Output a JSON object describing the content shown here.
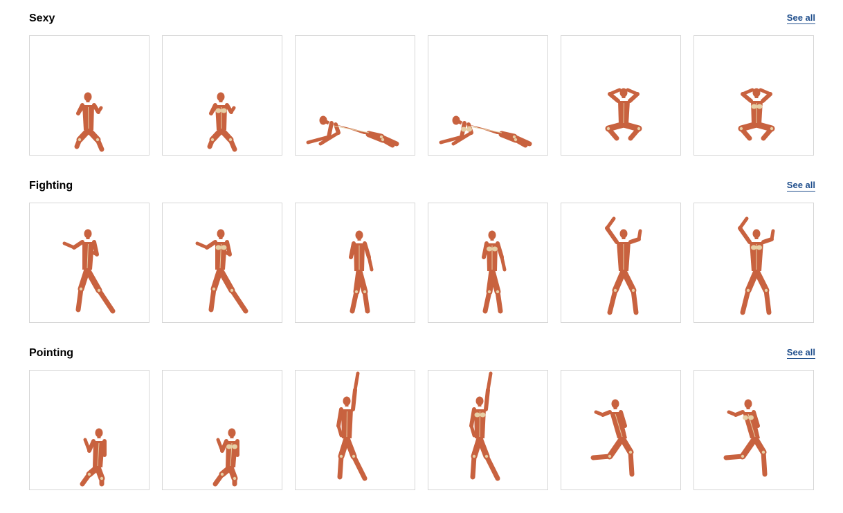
{
  "sections": [
    {
      "title": "Sexy",
      "see_all": "See all",
      "items": [
        {
          "pose": "kneeling-hands-raised",
          "figure": "male"
        },
        {
          "pose": "kneeling-hands-raised",
          "figure": "female"
        },
        {
          "pose": "lying-propped-on-elbow",
          "figure": "male"
        },
        {
          "pose": "lying-propped-on-elbow",
          "figure": "female"
        },
        {
          "pose": "squatting-hands-behind-head",
          "figure": "male"
        },
        {
          "pose": "squatting-hands-behind-head",
          "figure": "female"
        }
      ]
    },
    {
      "title": "Fighting",
      "see_all": "See all",
      "items": [
        {
          "pose": "wide-stance-arm-across",
          "figure": "male"
        },
        {
          "pose": "wide-stance-arm-across",
          "figure": "female"
        },
        {
          "pose": "standing-guard",
          "figure": "male"
        },
        {
          "pose": "standing-guard",
          "figure": "female"
        },
        {
          "pose": "arms-raised-stance",
          "figure": "male"
        },
        {
          "pose": "arms-raised-stance",
          "figure": "female"
        }
      ]
    },
    {
      "title": "Pointing",
      "see_all": "See all",
      "items": [
        {
          "pose": "kneeling-pointing",
          "figure": "male"
        },
        {
          "pose": "kneeling-pointing",
          "figure": "female"
        },
        {
          "pose": "pointing-up",
          "figure": "male"
        },
        {
          "pose": "pointing-up",
          "figure": "female"
        },
        {
          "pose": "running-pointing",
          "figure": "male"
        },
        {
          "pose": "running-pointing",
          "figure": "female"
        }
      ]
    }
  ],
  "colors": {
    "muscle": "#c8623f",
    "tendon": "#e7cfa5",
    "link": "#1f4e8c",
    "border": "#d6d6d6"
  }
}
